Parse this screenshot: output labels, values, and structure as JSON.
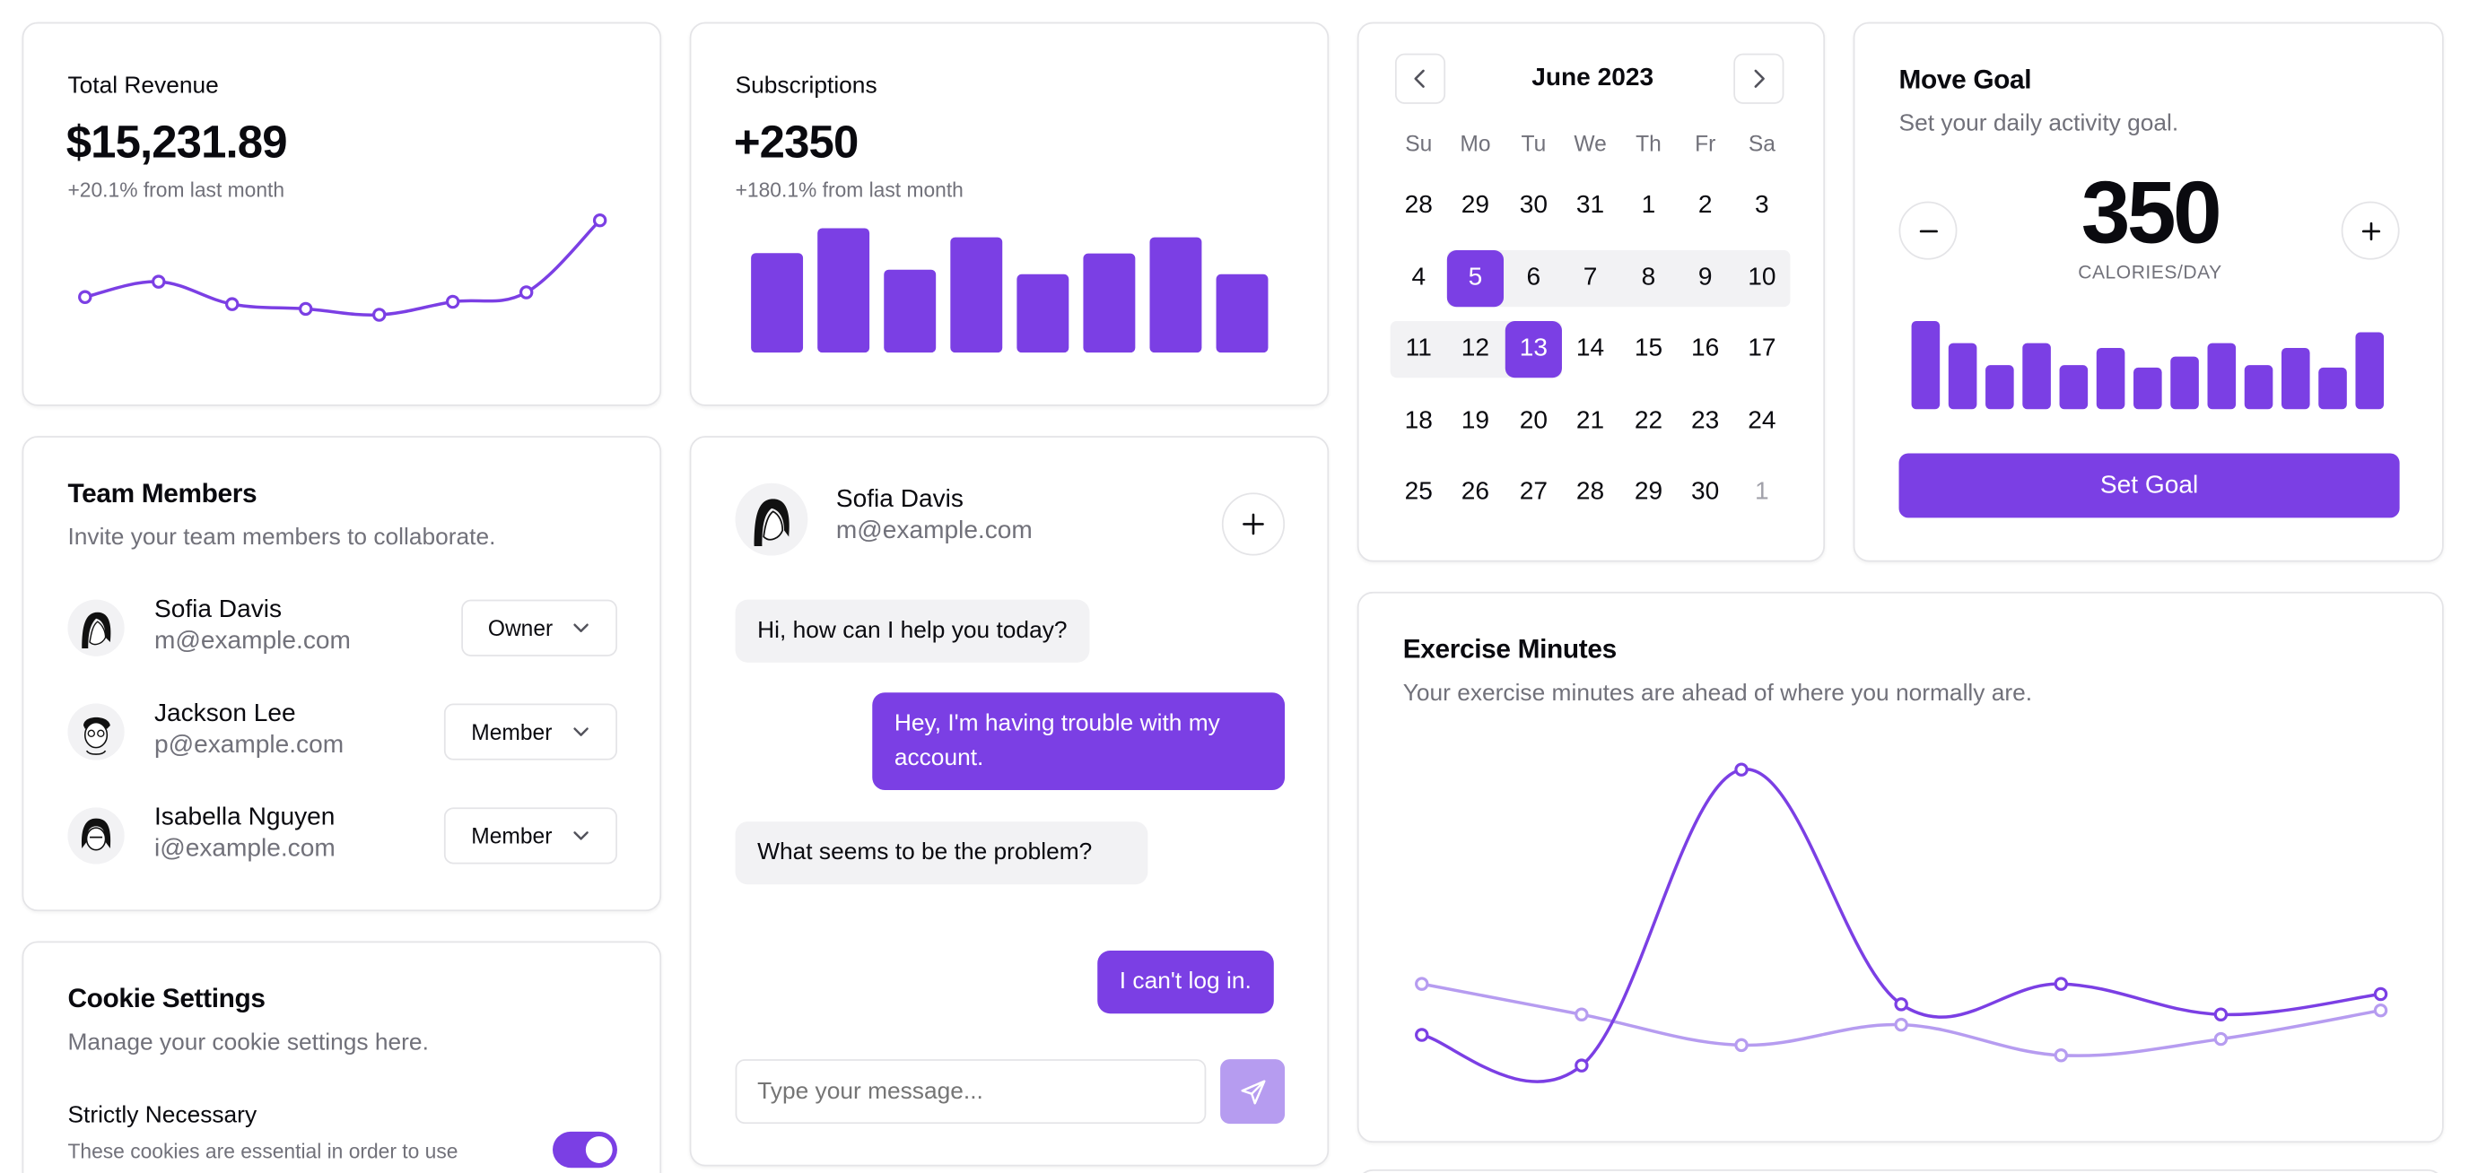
{
  "revenue": {
    "title": "Total Revenue",
    "value": "$15,231.89",
    "change": "+20.1% from last month"
  },
  "subscriptions": {
    "title": "Subscriptions",
    "value": "+2350",
    "change": "+180.1% from last month"
  },
  "calendar": {
    "month_label": "June 2023",
    "weekdays": [
      "Su",
      "Mo",
      "Tu",
      "We",
      "Th",
      "Fr",
      "Sa"
    ],
    "weeks": [
      [
        "28",
        "29",
        "30",
        "31",
        "1",
        "2",
        "3"
      ],
      [
        "4",
        "5",
        "6",
        "7",
        "8",
        "9",
        "10"
      ],
      [
        "11",
        "12",
        "13",
        "14",
        "15",
        "16",
        "17"
      ],
      [
        "18",
        "19",
        "20",
        "21",
        "22",
        "23",
        "24"
      ],
      [
        "25",
        "26",
        "27",
        "28",
        "29",
        "30",
        "1"
      ]
    ],
    "range_start": "5",
    "range_end": "13"
  },
  "move_goal": {
    "title": "Move Goal",
    "description": "Set your daily activity goal.",
    "value": "350",
    "unit": "CALORIES/DAY",
    "button_label": "Set Goal"
  },
  "team": {
    "title": "Team Members",
    "description": "Invite your team members to collaborate.",
    "members": [
      {
        "name": "Sofia Davis",
        "email": "m@example.com",
        "role": "Owner"
      },
      {
        "name": "Jackson Lee",
        "email": "p@example.com",
        "role": "Member"
      },
      {
        "name": "Isabella Nguyen",
        "email": "i@example.com",
        "role": "Member"
      }
    ]
  },
  "chat": {
    "contact_name": "Sofia Davis",
    "contact_email": "m@example.com",
    "messages": [
      {
        "from": "agent",
        "text": "Hi, how can I help you today?"
      },
      {
        "from": "user",
        "text": "Hey, I'm having trouble with my account."
      },
      {
        "from": "agent",
        "text": "What seems to be the problem?"
      },
      {
        "from": "user",
        "text": "I can't log in."
      }
    ],
    "input_placeholder": "Type your message..."
  },
  "cookies": {
    "title": "Cookie Settings",
    "description": "Manage your cookie settings here.",
    "item_title": "Strictly Necessary",
    "item_description": "These cookies are essential in order to use",
    "item_enabled": true
  },
  "exercise": {
    "title": "Exercise Minutes",
    "description": "Your exercise minutes are ahead of where you normally are."
  },
  "icons": {
    "prev": "chevron-left-icon",
    "next": "chevron-right-icon",
    "minus": "minus-icon",
    "plus": "plus-icon",
    "dropdown": "chevron-down-icon",
    "send": "send-icon"
  },
  "colors": {
    "accent": "#7b3fe4",
    "accent_light": "#b69cf0",
    "send_disabled": "#b69cf0",
    "range_bg": "#f2f2f4"
  },
  "chart_data": [
    {
      "id": "revenue",
      "type": "line",
      "series": [
        {
          "values": [
            10400,
            11700,
            9800,
            9400,
            8900,
            10000,
            10800,
            16900
          ]
        }
      ]
    },
    {
      "id": "subscriptions",
      "type": "bar",
      "series": [
        {
          "values": [
            240,
            300,
            200,
            278,
            189,
            239,
            278,
            189
          ]
        }
      ]
    },
    {
      "id": "move_goal",
      "type": "bar",
      "series": [
        {
          "values": [
            400,
            300,
            200,
            300,
            200,
            278,
            189,
            239,
            300,
            200,
            278,
            189,
            349
          ]
        }
      ]
    },
    {
      "id": "exercise",
      "type": "line",
      "series": [
        {
          "values": [
            200,
            185,
            330,
            215,
            225,
            210,
            220
          ]
        },
        {
          "values": [
            225,
            210,
            195,
            205,
            190,
            198,
            212
          ]
        }
      ]
    }
  ]
}
